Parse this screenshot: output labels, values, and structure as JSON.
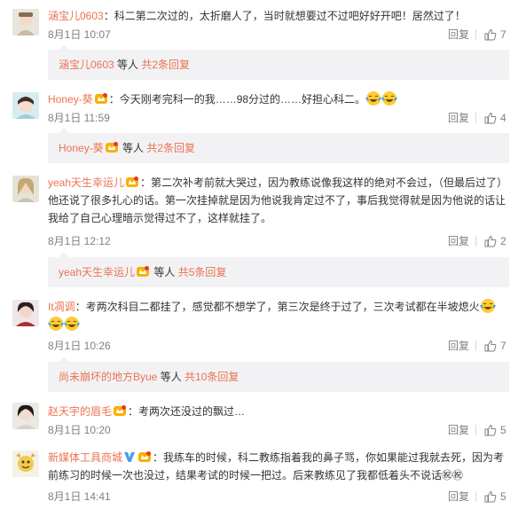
{
  "comments": [
    {
      "username": "涵宝儿0603",
      "has_vip_badge": false,
      "text": "：科二第二次过的，太折磨人了，当时就想要过不过吧好好开吧！居然过了！",
      "time": "8月1日 10:07",
      "reply_label": "回复",
      "likes": "7",
      "replies_summary": {
        "user": "涵宝儿0603",
        "middle": " 等人 ",
        "link": "共2条回复"
      }
    },
    {
      "username": "Honey-葵",
      "has_vip_badge": true,
      "text": "：今天刚考完科一的我……98分过的……好担心科二。",
      "time": "8月1日 11:59",
      "reply_label": "回复",
      "likes": "4",
      "replies_summary": {
        "user": "Honey-葵",
        "middle": " 等人 ",
        "link": "共2条回复"
      }
    },
    {
      "username": "yeah天生幸运儿",
      "has_vip_badge": true,
      "text": "：第二次补考前就大哭过，因为教练说像我这样的绝对不会过，（但最后过了）他还说了很多扎心的话。第一次挂掉就是因为他说我肯定过不了，事后我觉得就是因为他说的话让我给了自己心理暗示觉得过不了，这样就挂了。",
      "time": "8月1日 12:12",
      "reply_label": "回复",
      "likes": "2",
      "replies_summary": {
        "user": "yeah天生幸运儿",
        "middle": " 等人 ",
        "link": "共5条回复"
      }
    },
    {
      "username": "It凋调",
      "has_vip_badge": false,
      "text": "：考两次科目二都挂了，感觉都不想学了，第三次是终于过了，三次考试都在半坡熄火",
      "time": "8月1日 10:26",
      "reply_label": "回复",
      "likes": "7",
      "replies_summary": {
        "user": "尚未崩坏的地方Byue",
        "middle": " 等人 ",
        "link": "共10条回复"
      }
    },
    {
      "username": "赵天宇的眉毛",
      "has_vip_badge": true,
      "text": "：考两次还没过的飘过…",
      "time": "8月1日 10:20",
      "reply_label": "回复",
      "likes": "5"
    },
    {
      "username": "新媒体工具商城",
      "has_vip_badge": true,
      "has_verified_badge": true,
      "text": "：我练车的时候，科二教练指着我的鼻子骂，你如果能过我就去死，因为考前练习的时候一次也没过，结果考试的时候一把过。后来教练见了我都低着头不说话㊗㊗",
      "time": "8月1日 14:41",
      "reply_label": "回复",
      "likes": "5"
    }
  ],
  "icons": {
    "like": "thumbs-up-icon",
    "vip": "vip-crown-icon",
    "verified": "verified-v-icon",
    "emoji": "laughing-crying-emoji-icon"
  },
  "colors": {
    "username": "#eb7350",
    "text": "#333333",
    "meta": "#808080",
    "reply_box_bg": "#f2f2f5"
  }
}
